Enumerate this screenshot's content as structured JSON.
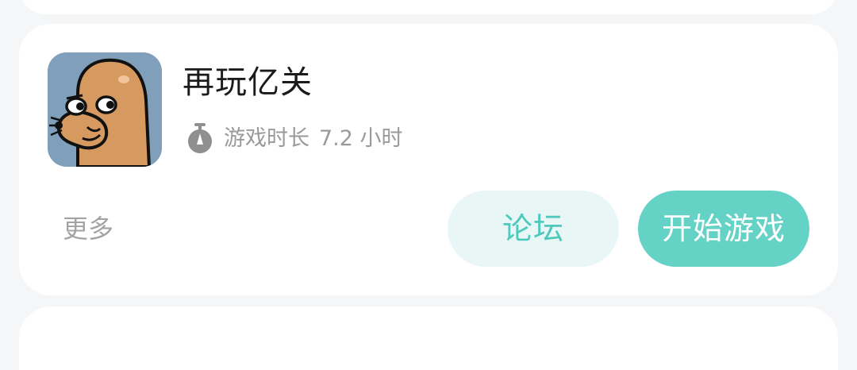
{
  "game": {
    "title": "再玩亿关",
    "playtime_label": "游戏时长",
    "playtime_value": "7.2 小时",
    "icon": "seal-character-icon"
  },
  "actions": {
    "more_label": "更多",
    "forum_label": "论坛",
    "start_label": "开始游戏"
  },
  "colors": {
    "accent": "#64d2c4",
    "accent_light": "#e8f7f6",
    "accent_text": "#4ec9bb",
    "muted_text": "#9a9a9a",
    "page_bg": "#f5f6f8"
  }
}
